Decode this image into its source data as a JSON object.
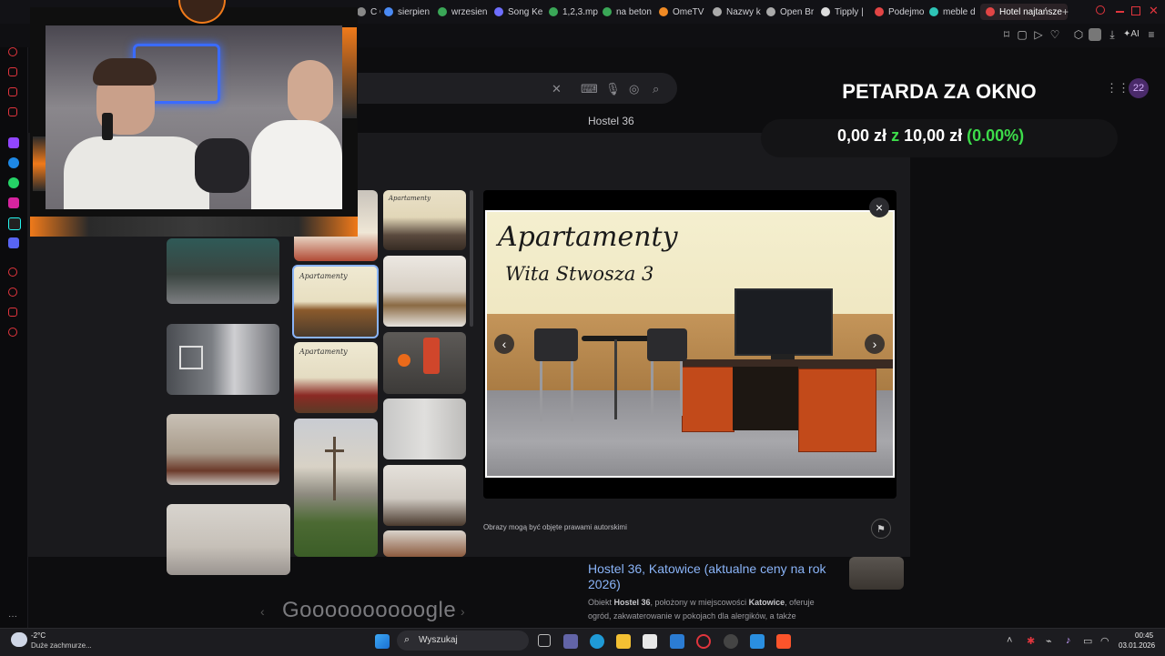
{
  "tabs": [
    {
      "label": "C C",
      "color": "#888888"
    },
    {
      "label": "sierpien",
      "color": "#4a8af4"
    },
    {
      "label": "wrzesien",
      "color": "#3aa757"
    },
    {
      "label": "Song Ke",
      "color": "#6e6eff"
    },
    {
      "label": "1,2,3.mp",
      "color": "#3aa757"
    },
    {
      "label": "na beton",
      "color": "#3aa757"
    },
    {
      "label": "OmeTV",
      "color": "#f08a24"
    },
    {
      "label": "Nazwy k",
      "color": "#aaaaaa"
    },
    {
      "label": "Open Br",
      "color": "#aaaaaa"
    },
    {
      "label": "Tipply |",
      "color": "#dddddd"
    },
    {
      "label": "Podejmo",
      "color": "#e24545"
    },
    {
      "label": "meble d",
      "color": "#2ec4b6"
    }
  ],
  "active_tab": {
    "label": "Hotel najtańsze",
    "color": "#e24545"
  },
  "toolbar": {
    "ai_label": "AI",
    "badge_count": "22"
  },
  "google": {
    "heading": "Hostel 36",
    "pager": "Goooooooooogle",
    "prev_icon": "‹",
    "next_icon": "›"
  },
  "viewer": {
    "image_title_line1": "Apartamenty",
    "image_title_line2": "Wita Stwosza 3",
    "copyright": "Obrazy mogą być objęte prawami autorskimi",
    "close_icon": "×",
    "prev_icon": "‹",
    "next_icon": "›",
    "flag_icon": "⚑"
  },
  "donation": {
    "title": "PETARDA ZA OKNO",
    "current": "0,00 zł",
    "separator": "z",
    "target": "10,00 zł",
    "percent": "(0.00%)",
    "progress": 0.0
  },
  "result": {
    "title": "Hostel 36, Katowice (aktualne ceny na rok 2026)",
    "desc_pre": "Obiekt ",
    "desc_b1": "Hostel 36",
    "desc_mid": ", położony w miejscowości ",
    "desc_b2": "Katowice",
    "desc_post": ", oferuje ogród, zakwaterowanie w pokojach dla alergików, a także"
  },
  "taskbar": {
    "weather_temp": "-2°C",
    "weather_desc": "Duże zachmurze...",
    "search_placeholder": "Wyszukaj",
    "time": "00:45",
    "date": "03.01.2026"
  },
  "colors": {
    "accent_green": "#3ddc4a",
    "link_blue": "#8ab4f8",
    "webcam_orange": "#f07a1a"
  }
}
